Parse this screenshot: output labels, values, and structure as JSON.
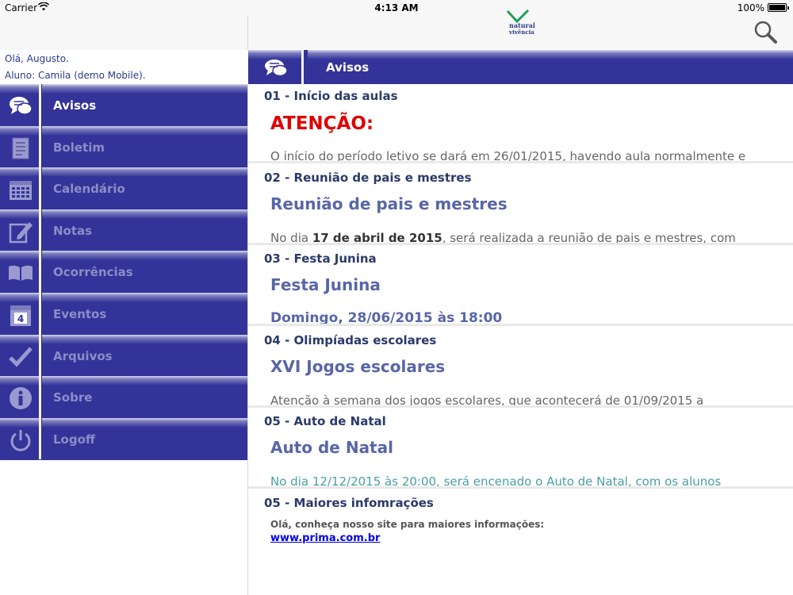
{
  "status_bar": {
    "carrier": "Carrier",
    "time": "4:13 AM",
    "battery": "100%"
  },
  "header": {
    "logo_line1": "natural",
    "logo_line2": "vivência"
  },
  "user": {
    "greeting": "Olá, Augusto.",
    "student": "Aluno: Camila (demo Mobile)."
  },
  "sidebar": {
    "items": [
      {
        "label": "Avisos",
        "icon": "chat-bubbles-icon"
      },
      {
        "label": "Boletim",
        "icon": "document-icon"
      },
      {
        "label": "Calendário",
        "icon": "calendar-icon"
      },
      {
        "label": "Notas",
        "icon": "edit-note-icon"
      },
      {
        "label": "Ocorrências",
        "icon": "open-book-icon"
      },
      {
        "label": "Eventos",
        "icon": "event-calendar-icon"
      },
      {
        "label": "Arquivos",
        "icon": "checkmark-icon"
      },
      {
        "label": "Sobre",
        "icon": "info-icon"
      },
      {
        "label": "Logoff",
        "icon": "power-icon"
      }
    ],
    "active_index": 0
  },
  "main": {
    "title": "Avisos"
  },
  "notices": [
    {
      "title": "01 - Início das aulas",
      "heading": "ATENÇÃO:",
      "body": "O início do período letivo se dará em 26/01/2015, havendo aula normalmente e"
    },
    {
      "title": "02 - Reunião de pais e mestres",
      "heading": "Reunião de pais e mestres",
      "body_pre": "No dia ",
      "body_bold": "17 de abril de 2015",
      "body_post": ", será realizada a reunião de pais e mestres, com"
    },
    {
      "title": "03 - Festa Junina",
      "heading": "Festa Junina",
      "body": "Domingo, 28/06/2015 às 18:00"
    },
    {
      "title": "04 - Olimpíadas escolares",
      "heading": "XVI Jogos escolares",
      "body": "Atenção à semana dos jogos escolares, que acontecerá de 01/09/2015 a"
    },
    {
      "title": "05 - Auto de Natal",
      "heading": "Auto de Natal",
      "body": "No dia 12/12/2015 às 20:00, será encenado o Auto de Natal, com os alunos"
    },
    {
      "title": "05 - Maiores infomrações",
      "text": "Olá, conheça nosso site para maiores informações:",
      "link": "www.prima.com.br"
    }
  ],
  "colors": {
    "nav_blue": "#333399",
    "alert_red": "#e00000",
    "heading_blue": "#5866a8",
    "link_blue": "#0000ee"
  }
}
